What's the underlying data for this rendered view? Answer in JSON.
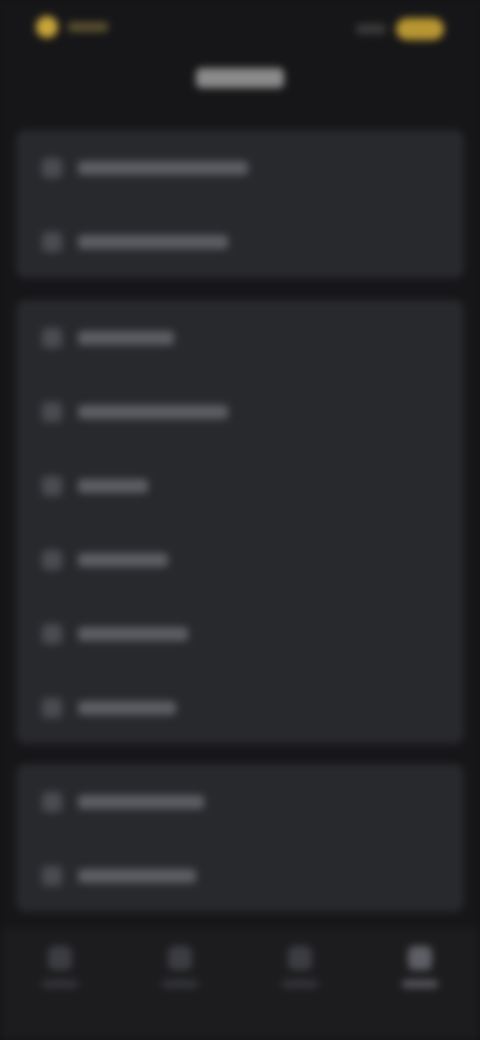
{
  "header": {
    "brand_label": "",
    "title": ""
  },
  "sections": [
    {
      "items": [
        {
          "icon": "settings-icon",
          "label": ""
        },
        {
          "icon": "settings-icon",
          "label": ""
        }
      ]
    },
    {
      "items": [
        {
          "icon": "list-icon",
          "label": ""
        },
        {
          "icon": "list-icon",
          "label": ""
        },
        {
          "icon": "list-icon",
          "label": ""
        },
        {
          "icon": "list-icon",
          "label": ""
        },
        {
          "icon": "list-icon",
          "label": ""
        },
        {
          "icon": "list-icon",
          "label": ""
        }
      ]
    },
    {
      "items": [
        {
          "icon": "info-icon",
          "label": ""
        },
        {
          "icon": "info-icon",
          "label": ""
        }
      ]
    }
  ],
  "bottom_nav": {
    "items": [
      {
        "icon": "home-icon",
        "label": "",
        "active": false
      },
      {
        "icon": "search-icon",
        "label": "",
        "active": false
      },
      {
        "icon": "bell-icon",
        "label": "",
        "active": false
      },
      {
        "icon": "profile-icon",
        "label": "",
        "active": true
      }
    ]
  },
  "colors": {
    "accent": "#c9a53a",
    "background": "#161618",
    "card": "#28292d"
  }
}
